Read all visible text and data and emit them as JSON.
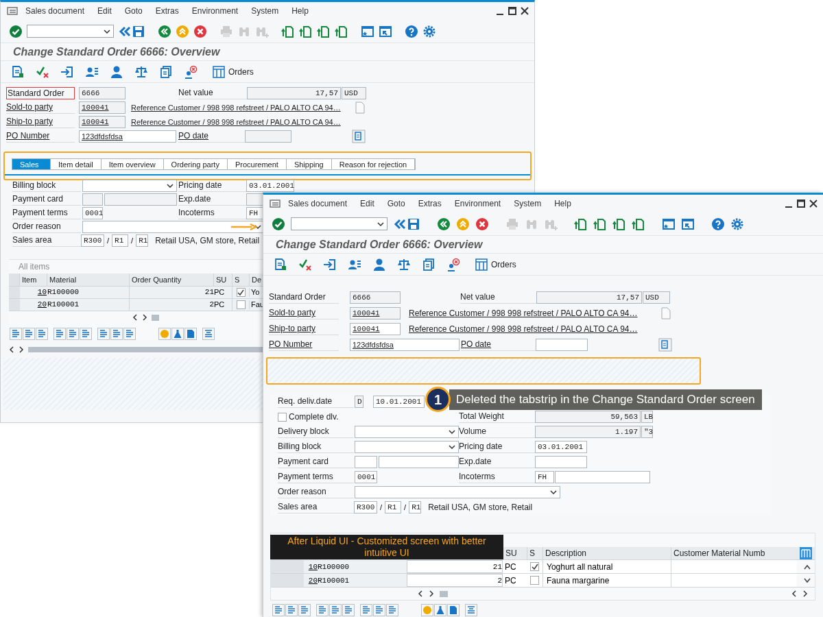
{
  "background_window": {
    "menu": [
      "Sales document",
      "Edit",
      "Goto",
      "Extras",
      "Environment",
      "System",
      "Help"
    ],
    "title": "Change Standard Order 6666: Overview",
    "orders_button": "Orders",
    "header": {
      "standard_order": {
        "label": "Standard Order",
        "value": "6666",
        "focused": true
      },
      "net_value": {
        "label": "Net value",
        "value": "17,57",
        "currency": "USD"
      },
      "sold_to": {
        "label": "Sold-to party",
        "value": "100041",
        "description": "Reference Customer / 998 998 refstreet / PALO ALTO CA 94…"
      },
      "ship_to": {
        "label": "Ship-to party",
        "value": "100041",
        "description": "Reference Customer / 998 998 refstreet / PALO ALTO CA 94…"
      },
      "po_number": {
        "label": "PO Number",
        "value": "123dfdsfdsa"
      },
      "po_date": {
        "label": "PO date"
      }
    },
    "tabs": [
      {
        "label": "Sales",
        "selected": true
      },
      {
        "label": "Item detail",
        "selected": false
      },
      {
        "label": "Item overview",
        "selected": false
      },
      {
        "label": "Ordering party",
        "selected": false
      },
      {
        "label": "Procurement",
        "selected": false
      },
      {
        "label": "Shipping",
        "selected": false
      },
      {
        "label": "Reason for rejection",
        "selected": false
      }
    ],
    "form": {
      "billing_block": {
        "label": "Billing block"
      },
      "pricing_date": {
        "label": "Pricing date",
        "value": "03.01.2001"
      },
      "payment_card": {
        "label": "Payment card"
      },
      "exp_date": {
        "label": "Exp.date"
      },
      "payment_terms": {
        "label": "Payment terms",
        "value": "0001"
      },
      "incoterms": {
        "label": "Incoterms",
        "value": "FH"
      },
      "order_reason": {
        "label": "Order reason"
      },
      "sales_area": {
        "label": "Sales area",
        "values": [
          "R300",
          "R1",
          "R1"
        ],
        "separators": [
          "/",
          "/"
        ],
        "description": "Retail USA, GM store, Retail"
      }
    },
    "items": {
      "title": "All items",
      "columns": [
        "Item",
        "Material",
        "Order Quantity",
        "SU",
        "S",
        "De"
      ],
      "rows": [
        {
          "item": "10",
          "material": "R100000",
          "quantity": "21",
          "unit": "PC",
          "checked": true,
          "description": "Yo"
        },
        {
          "item": "20",
          "material": "R100001",
          "quantity": "2",
          "unit": "PC",
          "checked": false,
          "description": "Fau"
        }
      ]
    }
  },
  "front_window": {
    "menu": [
      "Sales document",
      "Edit",
      "Goto",
      "Extras",
      "Environment",
      "System",
      "Help"
    ],
    "title": "Change Standard Order 6666: Overview",
    "orders_button": "Orders",
    "header": {
      "standard_order": {
        "label": "Standard Order",
        "value": "6666",
        "focused": false
      },
      "net_value": {
        "label": "Net value",
        "value": "17,57",
        "currency": "USD"
      },
      "sold_to": {
        "label": "Sold-to party",
        "value": "100041",
        "description": "Reference Customer / 998 998 refstreet / PALO ALTO CA 94…"
      },
      "ship_to": {
        "label": "Ship-to party",
        "value": "100041",
        "description": "Reference Customer / 998 998 refstreet / PALO ALTO CA 94…"
      },
      "po_number": {
        "label": "PO Number",
        "value": "123dfdsfdsa"
      },
      "po_date": {
        "label": "PO date"
      }
    },
    "form": {
      "req_deliv_date": {
        "label": "Req. deliv.date",
        "type": "D",
        "value": "10.01.2001"
      },
      "complete_dlv": {
        "label": "Complete dlv.",
        "checked": false
      },
      "total_weight": {
        "label": "Total Weight",
        "value": "59,563",
        "unit": "LB"
      },
      "delivery_block": {
        "label": "Delivery block"
      },
      "volume": {
        "label": "Volume",
        "value": "1.197",
        "unit": "\"3"
      },
      "billing_block": {
        "label": "Billing block"
      },
      "pricing_date": {
        "label": "Pricing date",
        "value": "03.01.2001"
      },
      "payment_card": {
        "label": "Payment card"
      },
      "exp_date": {
        "label": "Exp.date"
      },
      "payment_terms": {
        "label": "Payment terms",
        "value": "0001"
      },
      "incoterms": {
        "label": "Incoterms",
        "value": "FH"
      },
      "order_reason": {
        "label": "Order reason"
      },
      "sales_area": {
        "label": "Sales area",
        "values": [
          "R300",
          "R1",
          "R1"
        ],
        "separators": [
          "/",
          "/"
        ],
        "description": "Retail USA, GM store, Retail"
      }
    },
    "items": {
      "columns": [
        "SU",
        "S",
        "Description",
        "Customer Material Numb"
      ],
      "rows": [
        {
          "item": "10",
          "material": "R100000",
          "quantity": "21",
          "unit": "PC",
          "checked": true,
          "description": "Yoghurt all natural"
        },
        {
          "item": "20",
          "material": "R100001",
          "quantity": "2",
          "unit": "PC",
          "checked": false,
          "description": "Fauna margarine"
        }
      ]
    }
  },
  "callout": {
    "number": "1",
    "text": "Deleted the tabstrip in the Change Standard Order screen"
  },
  "caption": "After Liquid UI - Customized screen with better intuitive UI"
}
